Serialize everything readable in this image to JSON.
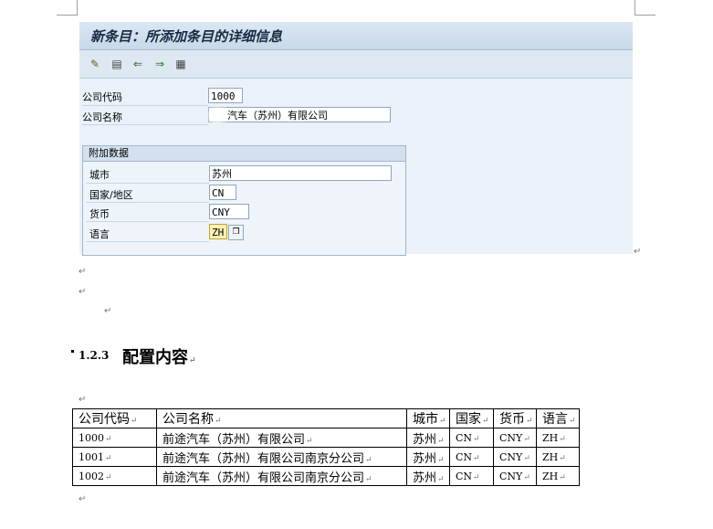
{
  "sap_screen": {
    "title": "新条目：所添加条目的详细信息",
    "toolbar_icons": [
      "edit-glasses-icon",
      "delete-row-icon",
      "undo-icon",
      "next-entry-icon",
      "select-all-icon"
    ],
    "fields": {
      "company_code": {
        "label": "公司代码",
        "value": "1000"
      },
      "company_name": {
        "label": "公司名称",
        "value": "汽车（苏州）有限公司"
      }
    },
    "group": {
      "title": "附加数据",
      "city": {
        "label": "城市",
        "value": "苏州"
      },
      "country": {
        "label": "国家/地区",
        "value": "CN"
      },
      "currency": {
        "label": "货币",
        "value": "CNY"
      },
      "language": {
        "label": "语言",
        "value": "ZH"
      }
    }
  },
  "document": {
    "paragraph_mark": "↵",
    "cell_mark": "↵",
    "heading": {
      "number": "1.2.3",
      "text": "配置内容"
    },
    "table": {
      "headers": [
        "公司代码",
        "公司名称",
        "城市",
        "国家",
        "货币",
        "语言"
      ],
      "rows": [
        [
          "1000",
          "前途汽车（苏州）有限公司",
          "苏州",
          "CN",
          "CNY",
          "ZH"
        ],
        [
          "1001",
          "前途汽车（苏州）有限公司南京分公司",
          "苏州",
          "CN",
          "CNY",
          "ZH"
        ],
        [
          "1002",
          "前途汽车（苏州）有限公司南京分公司",
          "苏州",
          "CN",
          "CNY",
          "ZH"
        ]
      ]
    }
  }
}
